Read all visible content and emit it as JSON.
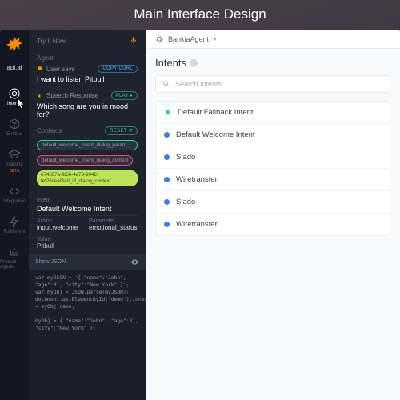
{
  "page_title": "Main Interface Design",
  "brand": "api.ai",
  "colors": {
    "accent_orange": "#ff8a00",
    "blue_dot": "#3f7de0",
    "teal": "#35c9aa",
    "lime": "#bde35a",
    "rail_bg": "#131721",
    "panel_bg": "#1e232e"
  },
  "rail": {
    "items": [
      {
        "label": "Intents",
        "icon": "target-icon",
        "active": true
      },
      {
        "label": "Entities",
        "icon": "cube-icon",
        "active": false
      },
      {
        "label": "Training",
        "icon": "grad-icon",
        "active": false,
        "badge": "BETA"
      },
      {
        "label": "Integration",
        "icon": "code-icon",
        "active": false
      },
      {
        "label": "Fulfillment",
        "icon": "bolt-icon",
        "active": false
      },
      {
        "label": "Prebuilt Agents",
        "icon": "robot-icon",
        "active": false
      }
    ]
  },
  "try_panel": {
    "title": "Try it Now",
    "agent_label": "Agent",
    "user_says_label": "User says",
    "copy_curl": "COPY CURL",
    "user_says": "I want to listen Pitbull",
    "speech_label": "Speech Response",
    "play": "PLAY ▸",
    "speech_response": "Which song are you in mood for?",
    "contexts_label": "Contexts",
    "reset": "RESET ↺",
    "contexts": [
      "default_welcome_intent_dialog_params_emotional",
      "default_welcome_intent_dialog_context",
      "674597a-fb56-4a73-9942-fef26ceaf8ad_id_dialog_context"
    ],
    "intent_label": "Intent",
    "intent": "Default Welcome Intent",
    "action_label": "Action",
    "action": "input.welcome",
    "parameter_label": "Parameter",
    "parameter": "emotional_status",
    "value_label": "Value",
    "value": "Pitbull",
    "show_json": "Show JSON",
    "code": "var myJSON = '{ \"name\":\"John\", \"age\":31, \"city\":\"New York\" }';\nvar myObj = JSON.parse(myJSON);\ndocument.getElementById(\"demo\").innerHTML = myObj.name;\n\nmyObj = { \"name\":\"John\", \"age\":31, \"city\":\"New York\" };"
  },
  "main": {
    "breadcrumb": "BankiaAgent",
    "heading": "Intents",
    "search_placeholder": "Search Intents",
    "intents": [
      {
        "label": "Default Fallback Intent",
        "marker": "bookmark"
      },
      {
        "label": "Default  Welcome Intent",
        "marker": "dot"
      },
      {
        "label": "Slado",
        "marker": "dot"
      },
      {
        "label": "Wiretransfer",
        "marker": "dot"
      },
      {
        "label": "Slado",
        "marker": "dot"
      },
      {
        "label": "Wiretransfer",
        "marker": "dot"
      }
    ]
  }
}
